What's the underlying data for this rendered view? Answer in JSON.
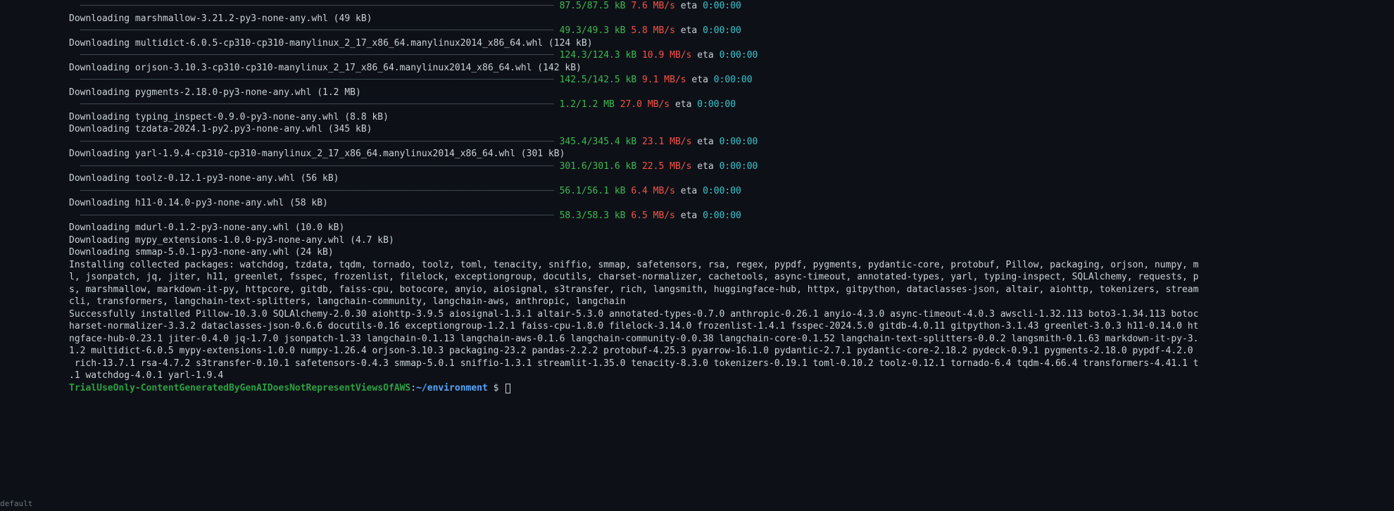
{
  "progress_bar_dashes": "  ────────────────────────────────────────────────────────────────────────────────────── ",
  "rows": [
    {
      "type": "bar",
      "size": "87.5/87.5 kB",
      "speed": "7.6 MB/s",
      "eta": "0:00:00"
    },
    {
      "type": "dl",
      "text": "Downloading marshmallow-3.21.2-py3-none-any.whl (49 kB)"
    },
    {
      "type": "bar",
      "size": "49.3/49.3 kB",
      "speed": "5.8 MB/s",
      "eta": "0:00:00"
    },
    {
      "type": "dl",
      "text": "Downloading multidict-6.0.5-cp310-cp310-manylinux_2_17_x86_64.manylinux2014_x86_64.whl (124 kB)"
    },
    {
      "type": "bar",
      "size": "124.3/124.3 kB",
      "speed": "10.9 MB/s",
      "eta": "0:00:00"
    },
    {
      "type": "dl",
      "text": "Downloading orjson-3.10.3-cp310-cp310-manylinux_2_17_x86_64.manylinux2014_x86_64.whl (142 kB)"
    },
    {
      "type": "bar",
      "size": "142.5/142.5 kB",
      "speed": "9.1 MB/s",
      "eta": "0:00:00"
    },
    {
      "type": "dl",
      "text": "Downloading pygments-2.18.0-py3-none-any.whl (1.2 MB)"
    },
    {
      "type": "bar",
      "size": "1.2/1.2 MB",
      "speed": "27.0 MB/s",
      "eta": "0:00:00"
    },
    {
      "type": "dl",
      "text": "Downloading typing_inspect-0.9.0-py3-none-any.whl (8.8 kB)"
    },
    {
      "type": "dl",
      "text": "Downloading tzdata-2024.1-py2.py3-none-any.whl (345 kB)"
    },
    {
      "type": "bar",
      "size": "345.4/345.4 kB",
      "speed": "23.1 MB/s",
      "eta": "0:00:00"
    },
    {
      "type": "dl",
      "text": "Downloading yarl-1.9.4-cp310-cp310-manylinux_2_17_x86_64.manylinux2014_x86_64.whl (301 kB)"
    },
    {
      "type": "bar",
      "size": "301.6/301.6 kB",
      "speed": "22.5 MB/s",
      "eta": "0:00:00"
    },
    {
      "type": "dl",
      "text": "Downloading toolz-0.12.1-py3-none-any.whl (56 kB)"
    },
    {
      "type": "bar",
      "size": "56.1/56.1 kB",
      "speed": "6.4 MB/s",
      "eta": "0:00:00"
    },
    {
      "type": "dl",
      "text": "Downloading h11-0.14.0-py3-none-any.whl (58 kB)"
    },
    {
      "type": "bar",
      "size": "58.3/58.3 kB",
      "speed": "6.5 MB/s",
      "eta": "0:00:00"
    },
    {
      "type": "dl",
      "text": "Downloading mdurl-0.1.2-py3-none-any.whl (10.0 kB)"
    },
    {
      "type": "dl",
      "text": "Downloading mypy_extensions-1.0.0-py3-none-any.whl (4.7 kB)"
    },
    {
      "type": "dl",
      "text": "Downloading smmap-5.0.1-py3-none-any.whl (24 kB)"
    }
  ],
  "installing": "Installing collected packages: watchdog, tzdata, tqdm, tornado, toolz, toml, tenacity, sniffio, smmap, safetensors, rsa, regex, pypdf, pygments, pydantic-core, protobuf, Pillow, packaging, orjson, numpy, m\nl, jsonpatch, jq, jiter, h11, greenlet, fsspec, frozenlist, filelock, exceptiongroup, docutils, charset-normalizer, cachetools, async-timeout, annotated-types, yarl, typing-inspect, SQLAlchemy, requests, p\ns, marshmallow, markdown-it-py, httpcore, gitdb, faiss-cpu, botocore, anyio, aiosignal, s3transfer, rich, langsmith, huggingface-hub, httpx, gitpython, dataclasses-json, altair, aiohttp, tokenizers, stream\ncli, transformers, langchain-text-splitters, langchain-community, langchain-aws, anthropic, langchain",
  "success": "Successfully installed Pillow-10.3.0 SQLAlchemy-2.0.30 aiohttp-3.9.5 aiosignal-1.3.1 altair-5.3.0 annotated-types-0.7.0 anthropic-0.26.1 anyio-4.3.0 async-timeout-4.0.3 awscli-1.32.113 boto3-1.34.113 botoc\nharset-normalizer-3.3.2 dataclasses-json-0.6.6 docutils-0.16 exceptiongroup-1.2.1 faiss-cpu-1.8.0 filelock-3.14.0 frozenlist-1.4.1 fsspec-2024.5.0 gitdb-4.0.11 gitpython-3.1.43 greenlet-3.0.3 h11-0.14.0 ht\nngface-hub-0.23.1 jiter-0.4.0 jq-1.7.0 jsonpatch-1.33 langchain-0.1.13 langchain-aws-0.1.6 langchain-community-0.0.38 langchain-core-0.1.52 langchain-text-splitters-0.0.2 langsmith-0.1.63 markdown-it-py-3.\n1.2 multidict-6.0.5 mypy-extensions-1.0.0 numpy-1.26.4 orjson-3.10.3 packaging-23.2 pandas-2.2.2 protobuf-4.25.3 pyarrow-16.1.0 pydantic-2.7.1 pydantic-core-2.18.2 pydeck-0.9.1 pygments-2.18.0 pypdf-4.2.0 \n rich-13.7.1 rsa-4.7.2 s3transfer-0.10.1 safetensors-0.4.3 smmap-5.0.1 sniffio-1.3.1 streamlit-1.35.0 tenacity-8.3.0 tokenizers-0.19.1 toml-0.10.2 toolz-0.12.1 tornado-6.4 tqdm-4.66.4 transformers-4.41.1 t\n.1 watchdog-4.0.1 yarl-1.9.4",
  "prompt": {
    "host": "TrialUseOnly-ContentGeneratedByGenAIDoesNotRepresentViewsOfAWS",
    "sep": ":",
    "path": "~/environment",
    "sym": " $ "
  },
  "eta_label": " eta ",
  "footer": "default"
}
